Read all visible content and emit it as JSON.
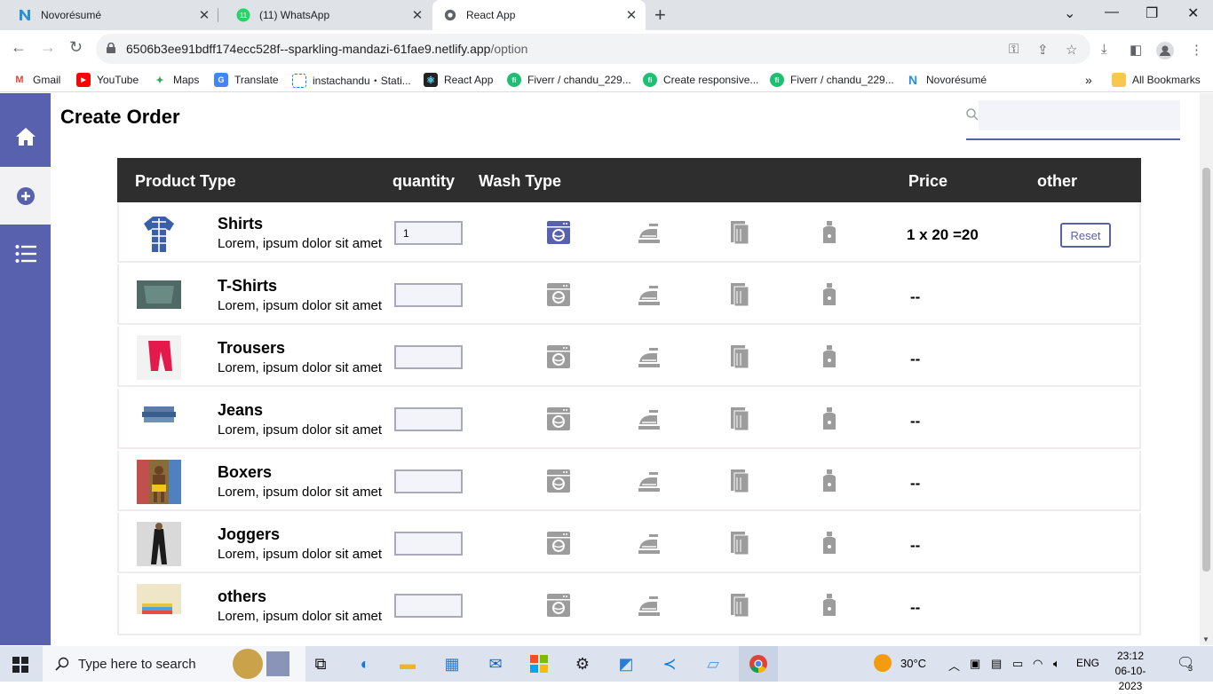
{
  "browser": {
    "tabs": [
      {
        "title": "Novorésumé",
        "favicon": "novoresume-n-icon"
      },
      {
        "title": "(11) WhatsApp",
        "favicon": "whatsapp-icon",
        "badge": "11"
      },
      {
        "title": "React App",
        "favicon": "globe-icon",
        "active": true
      }
    ],
    "url_host": "6506b3ee91bdff174ecc528f--sparkling-mandazi-61fae9.netlify.app",
    "url_path": "/option",
    "bookmarks": [
      {
        "label": "Gmail",
        "icon": "gmail-icon"
      },
      {
        "label": "YouTube",
        "icon": "youtube-icon"
      },
      {
        "label": "Maps",
        "icon": "maps-icon"
      },
      {
        "label": "Translate",
        "icon": "translate-icon"
      },
      {
        "label": "instachandu・Stati...",
        "icon": "dashed-square-icon"
      },
      {
        "label": "React App",
        "icon": "react-icon"
      },
      {
        "label": "Fiverr / chandu_229...",
        "icon": "fiverr-icon"
      },
      {
        "label": "Create responsive...",
        "icon": "fiverr-icon"
      },
      {
        "label": "Fiverr / chandu_229...",
        "icon": "fiverr-icon"
      },
      {
        "label": "Novorésumé",
        "icon": "novoresume-n-icon"
      }
    ],
    "all_bookmarks": "All Bookmarks"
  },
  "page": {
    "title": "Create Order",
    "search_placeholder": "",
    "headers": {
      "product_type": "Product Type",
      "quantity": "quantity",
      "wash_type": "Wash Type",
      "price": "Price",
      "other": "other"
    },
    "wash_icons": [
      "washing-machine-icon",
      "iron-icon",
      "towel-icon",
      "bleach-icon"
    ],
    "rows": [
      {
        "name": "Shirts",
        "desc": "Lorem, ipsum dolor sit amet",
        "qty": "1",
        "price": "1 x 20 =20",
        "reset": "Reset",
        "washing_selected": true
      },
      {
        "name": "T-Shirts",
        "desc": "Lorem, ipsum dolor sit amet",
        "qty": "",
        "price": "--"
      },
      {
        "name": "Trousers",
        "desc": "Lorem, ipsum dolor sit amet",
        "qty": "",
        "price": "--"
      },
      {
        "name": "Jeans",
        "desc": "Lorem, ipsum dolor sit amet",
        "qty": "",
        "price": "--"
      },
      {
        "name": "Boxers",
        "desc": "Lorem, ipsum dolor sit amet",
        "qty": "",
        "price": "--"
      },
      {
        "name": "Joggers",
        "desc": "Lorem, ipsum dolor sit amet",
        "qty": "",
        "price": "--"
      },
      {
        "name": "others",
        "desc": "Lorem, ipsum dolor sit amet",
        "qty": "",
        "price": "--"
      }
    ]
  },
  "colors": {
    "accent": "#5861ae",
    "header_bg": "#2e2e2e",
    "icon_gray": "#9c9c9c",
    "taskbar": "#dce3ee"
  },
  "taskbar": {
    "search_placeholder": "Type here to search",
    "weather": "30°C",
    "lang": "ENG",
    "time": "23:12",
    "date": "06-10-2023",
    "notifications": "3"
  }
}
